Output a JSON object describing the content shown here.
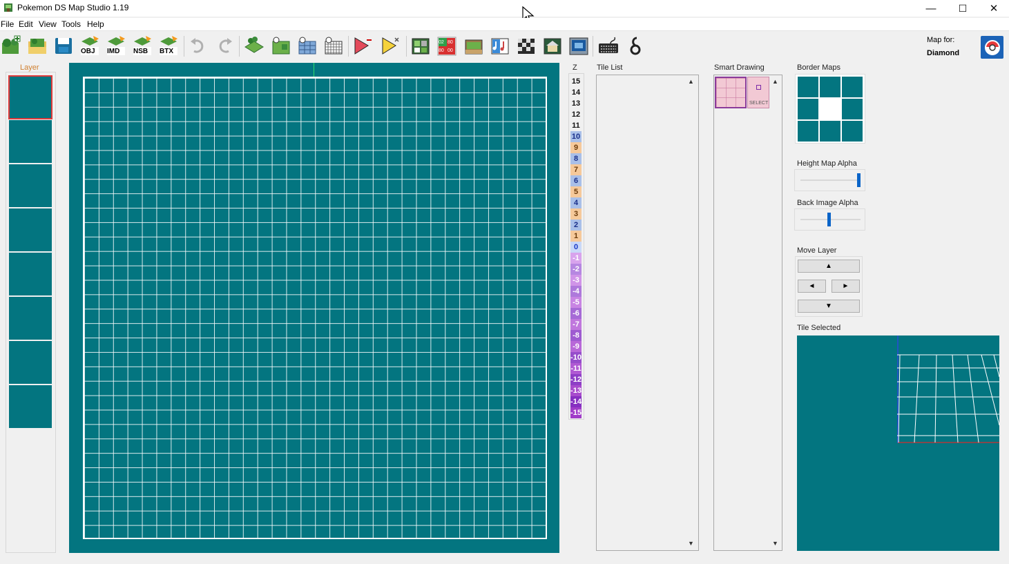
{
  "window": {
    "title": "Pokemon DS Map Studio 1.19",
    "controls": {
      "minimize": "—",
      "maximize": "☐",
      "close": "✕"
    }
  },
  "menu": [
    "File",
    "Edit",
    "View",
    "Tools",
    "Help"
  ],
  "toolbar": {
    "buttons": [
      {
        "name": "new-map",
        "text": ""
      },
      {
        "name": "open-map",
        "text": ""
      },
      {
        "name": "save-map",
        "text": ""
      },
      {
        "name": "export-obj",
        "text": "OBJ"
      },
      {
        "name": "export-imd",
        "text": "IMD"
      },
      {
        "name": "export-nsb",
        "text": "NSB"
      },
      {
        "name": "export-btx",
        "text": "BTX"
      },
      {
        "name": "undo",
        "text": ""
      },
      {
        "name": "redo",
        "text": ""
      }
    ],
    "palette_numbers": [
      "02",
      "80",
      "80",
      "00"
    ],
    "map_for_label": "Map for:",
    "map_for_value": "Diamond"
  },
  "layers": {
    "title": "Layer",
    "count": 8,
    "selected_index": 0
  },
  "z_panel": {
    "title": "Z",
    "levels": [
      "15",
      "14",
      "13",
      "12",
      "11",
      "10",
      "9",
      "8",
      "7",
      "6",
      "5",
      "4",
      "3",
      "2",
      "1",
      "0",
      "-1",
      "-2",
      "-3",
      "-4",
      "-5",
      "-6",
      "-7",
      "-8",
      "-9",
      "-10",
      "-11",
      "-12",
      "-13",
      "-14",
      "-15"
    ]
  },
  "tile_list": {
    "title": "Tile List"
  },
  "smart_drawing": {
    "title": "Smart Drawing",
    "select_label": "SELECT"
  },
  "border_maps": {
    "title": "Border Maps"
  },
  "height_map_alpha": {
    "title": "Height Map Alpha",
    "value": 1.0
  },
  "back_image_alpha": {
    "title": "Back Image Alpha",
    "value": 0.5
  },
  "move_layer": {
    "title": "Move Layer",
    "up": "▲",
    "left": "◄",
    "right": "►",
    "down": "▼"
  },
  "tile_selected": {
    "title": "Tile Selected"
  },
  "colors": {
    "map_teal": "#037580",
    "accent_blue": "#0a64c8",
    "bottom_z": "#e0404a"
  }
}
